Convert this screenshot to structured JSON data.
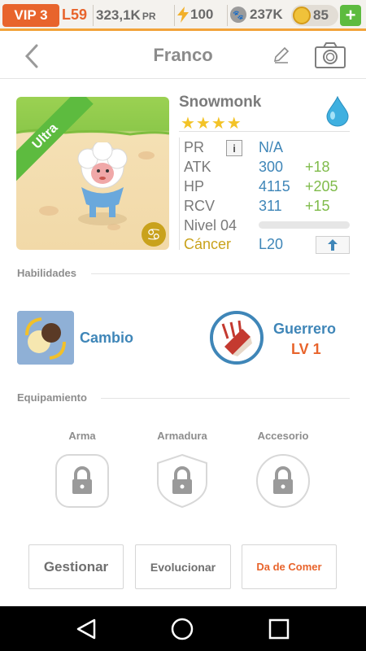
{
  "status_bar": {
    "vip": "VIP 3",
    "level": "L59",
    "pr_value": "323,1K",
    "pr_unit": "PR",
    "energy": "100",
    "paws": "237K",
    "coins": "85",
    "add_label": "+"
  },
  "header": {
    "title": "Franco"
  },
  "monster": {
    "rarity": "Ultra",
    "species": "Snowmonk",
    "stars": "★★★★",
    "stats": {
      "pr_label": "PR",
      "pr_info": "i",
      "pr_value": "N/A",
      "atk_label": "ATK",
      "atk_value": "300",
      "atk_bonus": "+18",
      "hp_label": "HP",
      "hp_value": "4115",
      "hp_bonus": "+205",
      "rcv_label": "RCV",
      "rcv_value": "311",
      "rcv_bonus": "+15"
    },
    "level_label": "Nivel 04",
    "level_progress": 0.0,
    "zodiac": "Cáncer",
    "zodiac_symbol": "♋",
    "max_level": "L20",
    "element_icon": "water-drop-icon"
  },
  "skills": {
    "section_label": "Habilidades",
    "skill_name": "Cambio",
    "class_name": "Guerrero",
    "class_level": "LV 1"
  },
  "equipment": {
    "section_label": "Equipamiento",
    "slots": [
      {
        "label": "Arma",
        "icon": "lock-icon"
      },
      {
        "label": "Armadura",
        "icon": "lock-icon"
      },
      {
        "label": "Accesorio",
        "icon": "lock-icon"
      }
    ]
  },
  "actions": {
    "manage": "Gestionar",
    "evolve": "Evolucionar",
    "feed": "Da de Comer"
  },
  "colors": {
    "accent_orange": "#e8642c",
    "accent_blue": "#3f86b8",
    "bonus_green": "#7fbb4a",
    "zodiac_gold": "#c9a21c"
  }
}
